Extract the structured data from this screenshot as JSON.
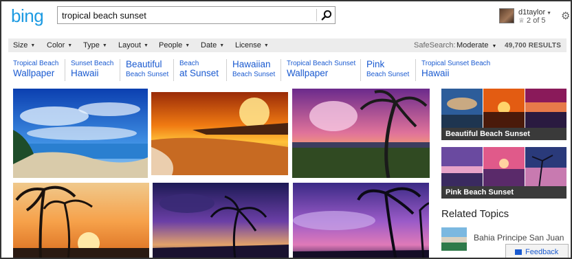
{
  "brand": {
    "logo_text": "bing"
  },
  "search": {
    "query": "tropical beach sunset"
  },
  "user": {
    "name": "d1taylor",
    "rewards": "2 of 5"
  },
  "filters": [
    "Size",
    "Color",
    "Type",
    "Layout",
    "People",
    "Date",
    "License"
  ],
  "safesearch": {
    "label": "SafeSearch:",
    "value": "Moderate"
  },
  "results_count": "49,700 RESULTS",
  "related_searches": [
    {
      "line1": "Tropical Beach",
      "line2": "Wallpaper"
    },
    {
      "line1": "Sunset Beach",
      "line2": "Hawaii"
    },
    {
      "line1": "Beautiful",
      "line2": "Beach Sunset"
    },
    {
      "line1": "Beach",
      "line2": "at Sunset"
    },
    {
      "line1": "Hawaiian",
      "line2": "Beach Sunset"
    },
    {
      "line1": "Tropical Beach Sunset",
      "line2": "Wallpaper"
    },
    {
      "line1": "Pink",
      "line2": "Beach Sunset"
    },
    {
      "line1": "Tropical Sunset Beach",
      "line2": "Hawaii"
    }
  ],
  "collages": [
    {
      "caption": "Beautiful Beach Sunset"
    },
    {
      "caption": "Pink Beach Sunset"
    }
  ],
  "related_topics": {
    "heading": "Related Topics",
    "items": [
      {
        "label": "Bahia Principe San Juan"
      }
    ]
  },
  "feedback": {
    "label": "Feedback"
  },
  "colors": {
    "link": "#1a5ad0",
    "logo": "#1d9be2",
    "filter_bg": "#ececec",
    "caption_bg": "#3a3a3a"
  },
  "icons": {
    "search": "search-icon",
    "settings": "gear-icon",
    "feedback": "feedback-icon",
    "rewards": "rewards-icon"
  }
}
